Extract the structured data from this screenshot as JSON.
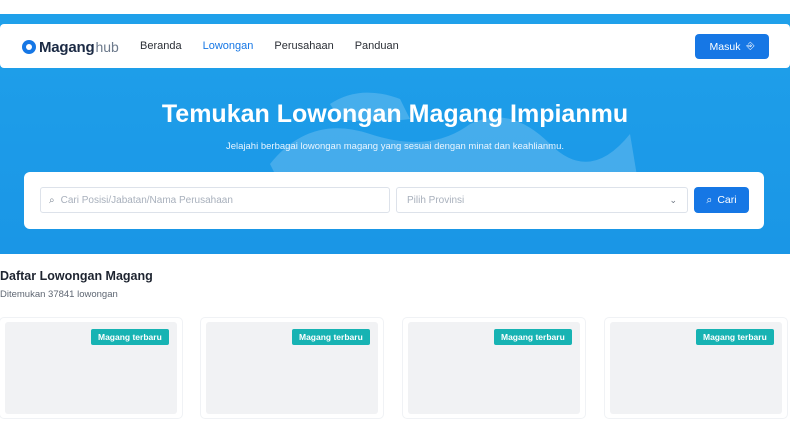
{
  "logo": {
    "main": "Magang",
    "sub": "hub"
  },
  "nav": {
    "links": [
      "Beranda",
      "Lowongan",
      "Perusahaan",
      "Panduan"
    ],
    "active": "Lowongan",
    "login_label": "Masuk",
    "login_icon": "login-arrow-icon"
  },
  "hero": {
    "title": "Temukan Lowongan Magang Impianmu",
    "subtitle": "Jelajahi berbagai lowongan magang yang sesuai dengan minat dan keahlianmu."
  },
  "search": {
    "placeholder": "Cari Posisi/Jabatan/Nama Perusahaan",
    "province_placeholder": "Pilih Provinsi",
    "button_label": "Cari"
  },
  "listing": {
    "title": "Daftar Lowongan Magang",
    "count_text": "Ditemukan 37841 lowongan",
    "cards": [
      {
        "badge": "Magang terbaru"
      },
      {
        "badge": "Magang terbaru"
      },
      {
        "badge": "Magang terbaru"
      },
      {
        "badge": "Magang terbaru"
      }
    ]
  },
  "colors": {
    "hero_bg": "#1fa0ea",
    "primary": "#1677e5",
    "badge": "#17b3b3"
  }
}
